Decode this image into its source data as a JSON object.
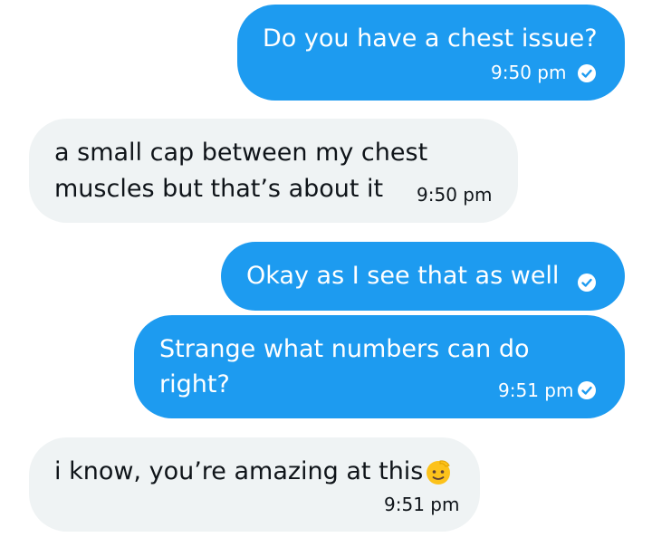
{
  "messages": [
    {
      "direction": "sent",
      "lines": [
        "Do you have a chest issue?"
      ],
      "time": "9:50 pm",
      "status": "check-circle-icon"
    },
    {
      "direction": "received",
      "lines": [
        "a small cap between my chest",
        "muscles but that’s about it"
      ],
      "time": "9:50 pm"
    },
    {
      "direction": "sent",
      "lines": [
        "Okay as I see that as well"
      ],
      "time": "",
      "status": "check-circle-icon"
    },
    {
      "direction": "sent",
      "lines": [
        "Strange what numbers can do",
        "right?"
      ],
      "time": "9:51 pm",
      "status": "check-circle-icon"
    },
    {
      "direction": "received",
      "lines": [
        "i know, you’re amazing at this"
      ],
      "emoji": "salute-face-emoji",
      "time": "9:51 pm"
    }
  ],
  "colors": {
    "sent_bubble": "#1d9bf0",
    "received_bubble": "#eff3f4",
    "sent_text": "#ffffff",
    "received_text": "#0f1419"
  }
}
